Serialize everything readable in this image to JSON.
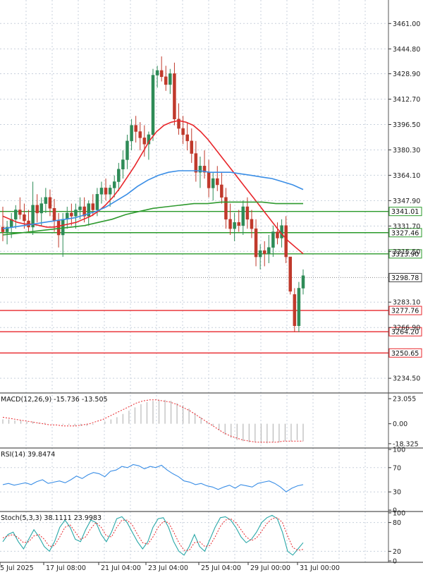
{
  "colors": {
    "bull": "#2e8b57",
    "bear": "#c0392b",
    "ma_fast": "#e8262b",
    "ma_mid": "#3a8ee6",
    "ma_slow": "#2f9a2f",
    "support": "#e8262b",
    "resistance": "#2a9a2a",
    "grid": "#c8d0dc",
    "current": "#888888"
  },
  "chart_data": [
    {
      "type": "candlestick",
      "name": "price",
      "ylim": [
        3226,
        3476
      ],
      "yticks": [
        "3461.00",
        "3444.80",
        "3428.90",
        "3412.70",
        "3396.50",
        "3380.30",
        "3364.10",
        "3347.90",
        "3331.70",
        "3315.50",
        "3283.10",
        "3266.90",
        "3234.50"
      ],
      "x_labels": [
        "5 Jul 2025",
        "17 Jul 08:00",
        "21 Jul 04:00",
        "23 Jul 04:00",
        "25 Jul 04:00",
        "29 Jul 00:00",
        "31 Jul 00:00"
      ],
      "candles": [
        [
          3331,
          3344,
          3322,
          3328
        ],
        [
          3328,
          3335,
          3320,
          3331
        ],
        [
          3331,
          3340,
          3324,
          3336
        ],
        [
          3336,
          3345,
          3330,
          3342
        ],
        [
          3342,
          3350,
          3336,
          3339
        ],
        [
          3339,
          3346,
          3330,
          3335
        ],
        [
          3335,
          3342,
          3328,
          3331
        ],
        [
          3331,
          3360,
          3326,
          3345
        ],
        [
          3345,
          3352,
          3334,
          3340
        ],
        [
          3340,
          3350,
          3332,
          3346
        ],
        [
          3346,
          3356,
          3340,
          3350
        ],
        [
          3350,
          3355,
          3338,
          3343
        ],
        [
          3343,
          3349,
          3328,
          3335
        ],
        [
          3335,
          3340,
          3318,
          3326
        ],
        [
          3326,
          3340,
          3312,
          3336
        ],
        [
          3336,
          3344,
          3330,
          3340
        ],
        [
          3340,
          3346,
          3332,
          3338
        ],
        [
          3338,
          3346,
          3330,
          3342
        ],
        [
          3342,
          3350,
          3336,
          3344
        ],
        [
          3344,
          3350,
          3334,
          3338
        ],
        [
          3338,
          3348,
          3332,
          3346
        ],
        [
          3346,
          3352,
          3338,
          3342
        ],
        [
          3342,
          3356,
          3338,
          3352
        ],
        [
          3352,
          3360,
          3346,
          3356
        ],
        [
          3356,
          3362,
          3348,
          3352
        ],
        [
          3352,
          3358,
          3344,
          3356
        ],
        [
          3356,
          3364,
          3350,
          3360
        ],
        [
          3360,
          3372,
          3354,
          3368
        ],
        [
          3368,
          3380,
          3362,
          3374
        ],
        [
          3374,
          3390,
          3368,
          3386
        ],
        [
          3386,
          3400,
          3380,
          3396
        ],
        [
          3396,
          3402,
          3385,
          3392
        ],
        [
          3392,
          3398,
          3380,
          3388
        ],
        [
          3388,
          3396,
          3376,
          3384
        ],
        [
          3384,
          3392,
          3374,
          3390
        ],
        [
          3390,
          3432,
          3386,
          3428
        ],
        [
          3428,
          3434,
          3420,
          3431
        ],
        [
          3431,
          3440,
          3424,
          3427
        ],
        [
          3427,
          3434,
          3418,
          3422
        ],
        [
          3422,
          3432,
          3416,
          3429
        ],
        [
          3429,
          3436,
          3396,
          3400
        ],
        [
          3400,
          3410,
          3390,
          3394
        ],
        [
          3394,
          3402,
          3384,
          3390
        ],
        [
          3390,
          3398,
          3380,
          3386
        ],
        [
          3386,
          3394,
          3372,
          3378
        ],
        [
          3378,
          3386,
          3360,
          3366
        ],
        [
          3366,
          3376,
          3356,
          3370
        ],
        [
          3370,
          3380,
          3362,
          3366
        ],
        [
          3366,
          3374,
          3350,
          3356
        ],
        [
          3356,
          3366,
          3348,
          3362
        ],
        [
          3362,
          3370,
          3354,
          3358
        ],
        [
          3358,
          3366,
          3346,
          3350
        ],
        [
          3350,
          3356,
          3330,
          3336
        ],
        [
          3336,
          3346,
          3326,
          3330
        ],
        [
          3330,
          3340,
          3322,
          3334
        ],
        [
          3334,
          3342,
          3328,
          3332
        ],
        [
          3332,
          3348,
          3326,
          3344
        ],
        [
          3344,
          3350,
          3330,
          3336
        ],
        [
          3336,
          3342,
          3324,
          3330
        ],
        [
          3330,
          3336,
          3306,
          3312
        ],
        [
          3312,
          3320,
          3304,
          3316
        ],
        [
          3316,
          3322,
          3306,
          3314
        ],
        [
          3314,
          3326,
          3308,
          3318
        ],
        [
          3318,
          3332,
          3312,
          3328
        ],
        [
          3328,
          3334,
          3320,
          3324
        ],
        [
          3324,
          3336,
          3318,
          3332
        ],
        [
          3332,
          3338,
          3308,
          3312
        ],
        [
          3312,
          3296,
          3288,
          3290
        ],
        [
          3288,
          3292,
          3264,
          3268
        ],
        [
          3268,
          3296,
          3264,
          3292
        ],
        [
          3292,
          3304,
          3288,
          3300
        ]
      ],
      "lines": [
        {
          "name": "ma_fast",
          "y": [
            3338,
            3336,
            3334,
            3333,
            3333,
            3332,
            3331,
            3331,
            3332,
            3333,
            3334,
            3336,
            3338,
            3341,
            3345,
            3350,
            3356,
            3363,
            3370,
            3378,
            3386,
            3392,
            3396,
            3398,
            3399,
            3398,
            3396,
            3392,
            3387,
            3381,
            3375,
            3369,
            3363,
            3357,
            3351,
            3345,
            3339,
            3333,
            3327,
            3322,
            3318,
            3314
          ]
        },
        {
          "name": "ma_mid",
          "y": [
            3330,
            3331,
            3332,
            3333,
            3334,
            3335,
            3336,
            3337,
            3339,
            3341,
            3344,
            3348,
            3352,
            3357,
            3361,
            3364,
            3366,
            3367,
            3367,
            3367,
            3366,
            3366,
            3366,
            3365,
            3364,
            3363,
            3362,
            3360,
            3358,
            3355
          ]
        },
        {
          "name": "ma_slow",
          "y": [
            3326,
            3327,
            3328,
            3329,
            3330,
            3331,
            3332,
            3334,
            3336,
            3339,
            3341,
            3343,
            3344,
            3345,
            3346,
            3346,
            3347,
            3347,
            3347,
            3347,
            3346,
            3346,
            3346
          ]
        }
      ],
      "levels": [
        {
          "value": "3341.01",
          "kind": "resistance"
        },
        {
          "value": "3327.46",
          "kind": "resistance"
        },
        {
          "value": "3313.90",
          "kind": "resistance"
        },
        {
          "value": "3298.78",
          "kind": "current"
        },
        {
          "value": "3277.76",
          "kind": "support"
        },
        {
          "value": "3264.20",
          "kind": "support"
        },
        {
          "value": "3250.65",
          "kind": "support"
        }
      ]
    },
    {
      "type": "bar+line",
      "name": "MACD",
      "title": "MACD(12,26,9) -15.736 -13.505",
      "yticks": [
        "23.055",
        "0.00",
        "-18.325"
      ],
      "ylim": [
        -21,
        27
      ],
      "histogram": [
        4,
        4,
        3,
        3,
        2,
        2,
        1,
        1,
        0,
        0,
        -1,
        -1,
        -2,
        -2,
        -2,
        -1,
        0,
        2,
        4,
        6,
        9,
        12,
        15,
        18,
        20,
        21,
        22,
        22,
        21,
        19,
        17,
        14,
        10,
        6,
        2,
        -2,
        -6,
        -10,
        -13,
        -15,
        -16,
        -17,
        -17,
        -18,
        -18,
        -17,
        -17,
        -16,
        -16,
        -15,
        -16
      ],
      "signal": [
        6,
        5,
        4,
        3,
        2,
        1,
        0,
        -1,
        -1,
        -2,
        -2,
        -2,
        -1,
        0,
        2,
        4,
        7,
        10,
        13,
        16,
        19,
        21,
        22,
        22,
        21,
        20,
        18,
        15,
        12,
        8,
        4,
        0,
        -4,
        -8,
        -11,
        -13,
        -15,
        -16,
        -17,
        -17,
        -17,
        -17,
        -16,
        -16,
        -16,
        -16
      ]
    },
    {
      "type": "line",
      "name": "RSI",
      "title": "RSI(14) 39.8474",
      "yticks": [
        "100",
        "70",
        "30",
        "0"
      ],
      "ylim": [
        0,
        100
      ],
      "y": [
        42,
        44,
        41,
        43,
        45,
        42,
        47,
        50,
        44,
        46,
        48,
        45,
        50,
        56,
        52,
        58,
        62,
        60,
        55,
        64,
        66,
        72,
        70,
        75,
        73,
        68,
        72,
        70,
        74,
        66,
        60,
        55,
        48,
        46,
        42,
        44,
        40,
        38,
        34,
        38,
        41,
        36,
        42,
        40,
        38,
        44,
        46,
        48,
        44,
        38,
        30,
        36,
        40,
        42
      ]
    },
    {
      "type": "line",
      "name": "Stoch",
      "title": "Stoch(5,3,3) 38.1111 23.9983",
      "yticks": [
        "100",
        "80",
        "20",
        "0"
      ],
      "ylim": [
        0,
        100
      ],
      "k": [
        40,
        55,
        60,
        40,
        25,
        45,
        65,
        50,
        30,
        20,
        40,
        70,
        85,
        70,
        45,
        40,
        65,
        85,
        80,
        55,
        40,
        60,
        88,
        92,
        80,
        60,
        40,
        25,
        40,
        70,
        88,
        90,
        70,
        40,
        20,
        12,
        30,
        55,
        30,
        20,
        45,
        70,
        90,
        92,
        85,
        70,
        50,
        38,
        45,
        60,
        80,
        90,
        95,
        88,
        60,
        20,
        12,
        25,
        38
      ],
      "d": [
        48,
        52,
        55,
        48,
        38,
        40,
        52,
        55,
        45,
        30,
        32,
        50,
        70,
        75,
        60,
        45,
        50,
        68,
        80,
        70,
        52,
        50,
        70,
        85,
        85,
        75,
        55,
        38,
        35,
        50,
        70,
        82,
        80,
        60,
        38,
        22,
        22,
        38,
        40,
        30,
        32,
        50,
        72,
        85,
        88,
        80,
        65,
        50,
        42,
        48,
        62,
        78,
        88,
        90,
        80,
        52,
        28,
        22,
        24
      ]
    }
  ]
}
